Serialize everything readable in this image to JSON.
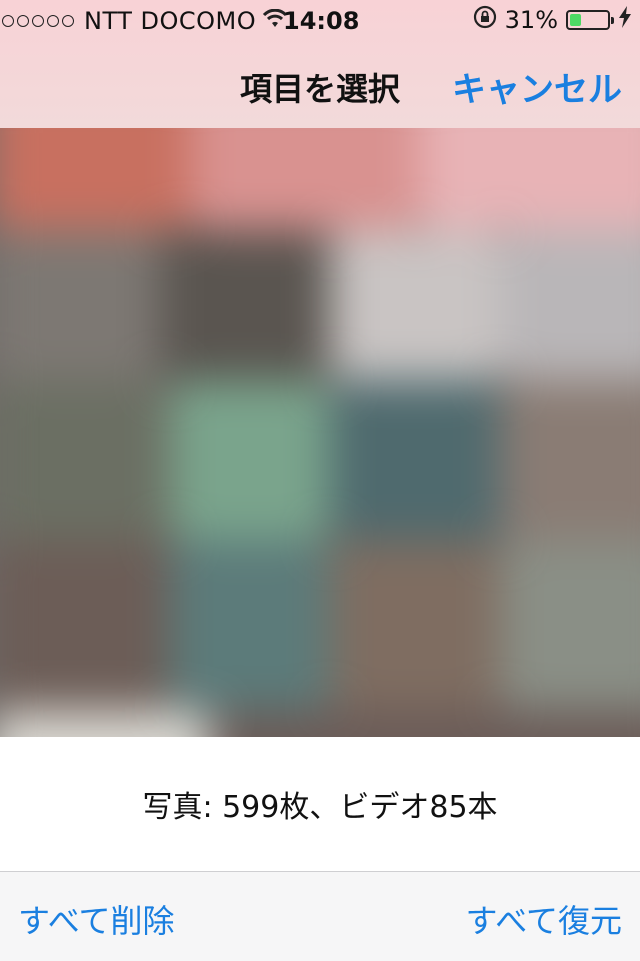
{
  "status_bar": {
    "carrier": "NTT DOCOMO",
    "time": "14:08",
    "battery": "31%",
    "battery_level": 0.31,
    "signal_dots": 5,
    "icons": [
      "signal-dots-icon",
      "wifi-icon",
      "rotation-lock-icon",
      "battery-icon",
      "charging-bolt-icon"
    ]
  },
  "nav": {
    "title": "項目を選択",
    "cancel_label": "キャンセル"
  },
  "summary": {
    "count_text": "写真: 599枚、ビデオ85本"
  },
  "toolbar": {
    "delete_all_label": "すべて削除",
    "restore_all_label": "すべて復元"
  },
  "colors": {
    "accent": "#1a7fe0",
    "battery_fill": "#4cd964",
    "header_tint": "#f8d2d6"
  }
}
